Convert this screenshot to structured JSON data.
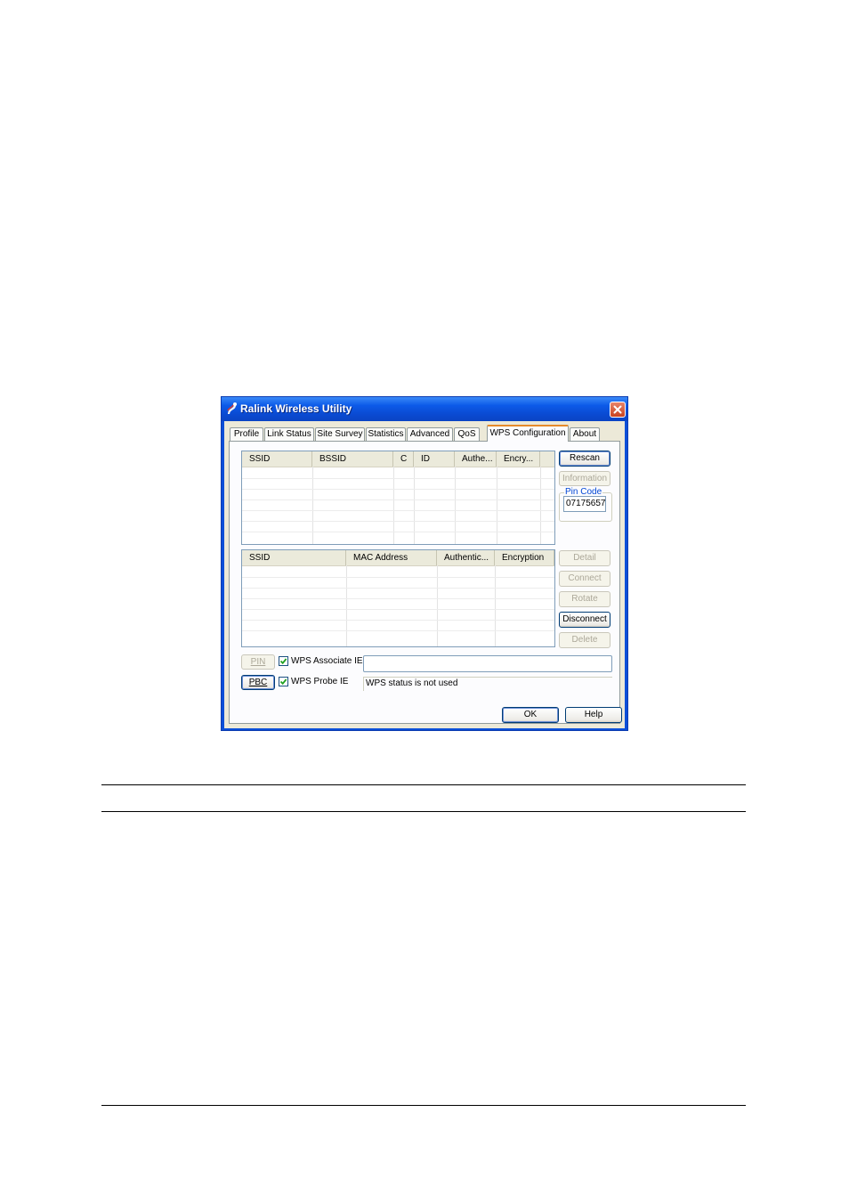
{
  "window": {
    "title": "Ralink Wireless Utility"
  },
  "tabs": [
    {
      "label": "Profile"
    },
    {
      "label": "Link Status"
    },
    {
      "label": "Site Survey"
    },
    {
      "label": "Statistics"
    },
    {
      "label": "Advanced"
    },
    {
      "label": "QoS"
    },
    {
      "label": "WPS Configuration"
    },
    {
      "label": "About"
    }
  ],
  "active_tab": "WPS Configuration",
  "ap_list": {
    "columns": [
      "SSID",
      "BSSID",
      "C",
      "ID",
      "Authe...",
      "Encry..."
    ],
    "rows": []
  },
  "profile_list": {
    "columns": [
      "SSID",
      "MAC Address",
      "Authentic...",
      "Encryption"
    ],
    "rows": []
  },
  "buttons": {
    "rescan": "Rescan",
    "information": "Information",
    "detail": "Detail",
    "connect": "Connect",
    "rotate": "Rotate",
    "disconnect": "Disconnect",
    "delete": "Delete",
    "pin": "PIN",
    "pbc": "PBC",
    "ok": "OK",
    "help": "Help"
  },
  "pin_code": {
    "label": "Pin Code",
    "value": "07175657"
  },
  "checkboxes": {
    "wps_associate_ie": {
      "label": "WPS Associate IE",
      "checked": true
    },
    "wps_probe_ie": {
      "label": "WPS Probe IE",
      "checked": true
    }
  },
  "wps_status": {
    "text": "WPS status is not used"
  },
  "colors": {
    "title_bar": "#0a4fd8",
    "active_tab_accent": "#e68b2c",
    "dialog_face": "#ece9d8",
    "close_button": "#d6512c"
  }
}
